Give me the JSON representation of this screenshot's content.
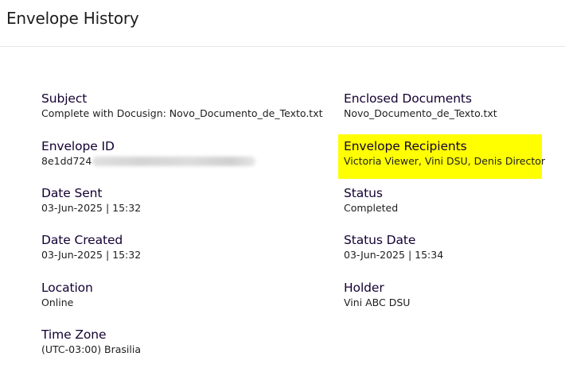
{
  "header": {
    "title": "Envelope History"
  },
  "details": {
    "subject": {
      "label": "Subject",
      "value": "Complete with Docusign: Novo_Documento_de_Texto.txt"
    },
    "enclosed_documents": {
      "label": "Enclosed Documents",
      "value": "Novo_Documento_de_Texto.txt"
    },
    "envelope_id": {
      "label": "Envelope ID",
      "value": "8e1dd724"
    },
    "envelope_recipients": {
      "label": "Envelope Recipients",
      "value": "Victoria Viewer, Vini DSU, Denis Director"
    },
    "date_sent": {
      "label": "Date Sent",
      "value": "03-Jun-2025 | 15:32"
    },
    "status": {
      "label": "Status",
      "value": "Completed"
    },
    "date_created": {
      "label": "Date Created",
      "value": "03-Jun-2025 | 15:32"
    },
    "status_date": {
      "label": "Status Date",
      "value": "03-Jun-2025 | 15:34"
    },
    "location": {
      "label": "Location",
      "value": "Online"
    },
    "holder": {
      "label": "Holder",
      "value": "Vini ABC DSU"
    },
    "time_zone": {
      "label": "Time Zone",
      "value": "(UTC-03:00) Brasilia"
    }
  },
  "colors": {
    "highlight": "#ffff00",
    "label": "#130032",
    "text": "#1e1e1e",
    "divider": "#e5e5e5"
  }
}
